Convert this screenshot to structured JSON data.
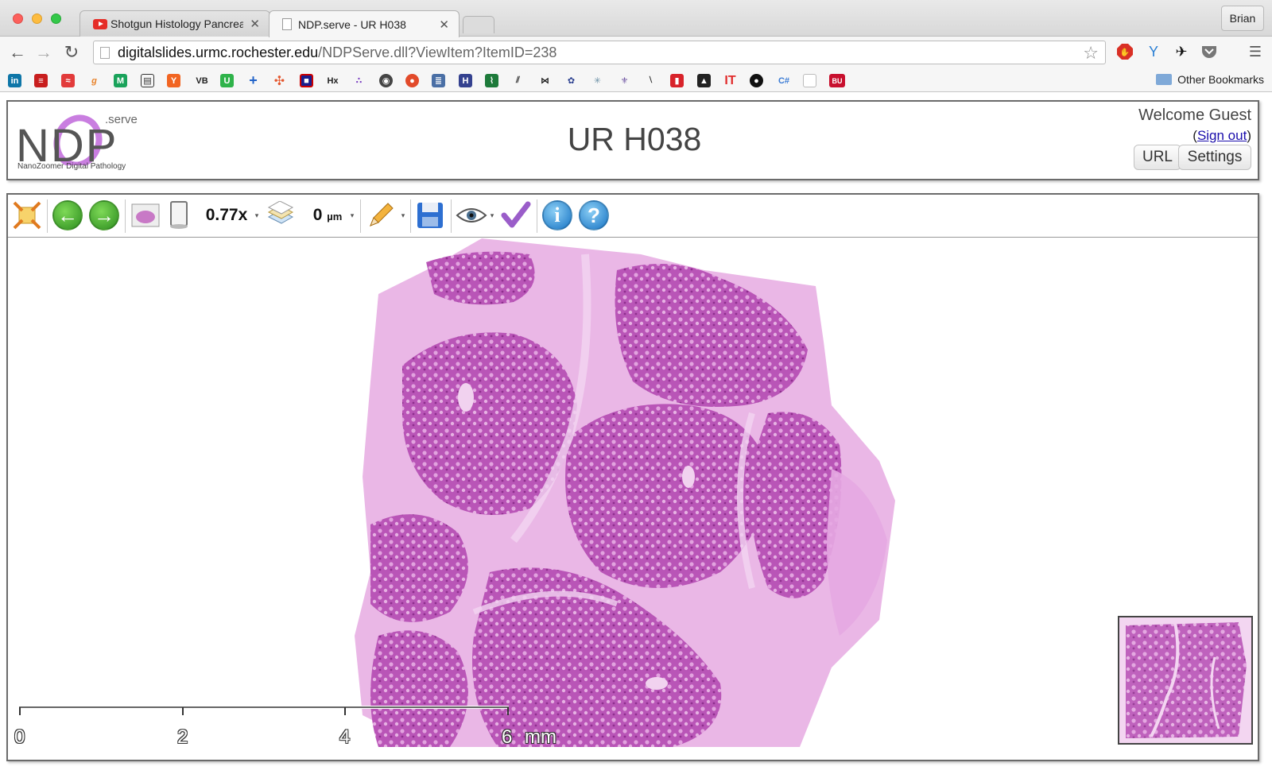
{
  "browser": {
    "tabs": [
      {
        "title": "Shotgun Histology Pancrea"
      },
      {
        "title": "NDP.serve - UR H038"
      }
    ],
    "profile_name": "Brian",
    "url_host": "digitalslides.urmc.rochester.edu",
    "url_path": "/NDPServe.dll?ViewItem?ItemID=238",
    "other_bookmarks": "Other Bookmarks"
  },
  "header": {
    "logo_word": "NDP",
    "logo_serve": ".serve",
    "logo_subtitle": "NanoZoomer Digital Pathology",
    "title": "UR H038",
    "welcome": "Welcome Guest",
    "signout_open": "(",
    "signout_label": "Sign out",
    "signout_close": ")",
    "url_button": "URL",
    "settings_button": "Settings"
  },
  "viewer": {
    "zoom": "0.77x",
    "focus_value": "0",
    "focus_unit": "µm",
    "scale_labels": [
      "0",
      "2",
      "4",
      "6"
    ],
    "scale_unit": "mm"
  },
  "colors": {
    "tissue_light": "#e6a9e2",
    "tissue_dark": "#b54bb4",
    "frame_border": "#6b6b6b"
  }
}
